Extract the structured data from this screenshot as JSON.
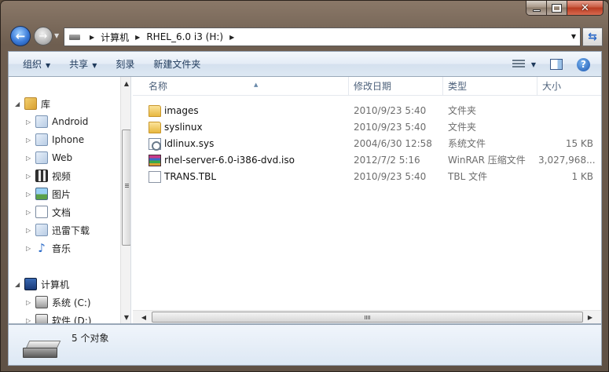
{
  "address": {
    "crumbs": [
      "计算机",
      "RHEL_6.0 i3 (H:)"
    ]
  },
  "toolbar": {
    "organize": "组织",
    "share": "共享",
    "burn": "刻录",
    "new_folder": "新建文件夹"
  },
  "nav": {
    "libraries_label": "库",
    "libraries": [
      "Android",
      "Iphone",
      "Web",
      "视频",
      "图片",
      "文档",
      "迅雷下载",
      "音乐"
    ],
    "computer_label": "计算机",
    "drives": [
      "系统 (C:)",
      "软件 (D:)"
    ]
  },
  "columns": {
    "name": "名称",
    "date": "修改日期",
    "type": "类型",
    "size": "大小"
  },
  "files": [
    {
      "name": "images",
      "date": "2010/9/23 5:40",
      "type": "文件夹",
      "size": "",
      "icon": "folder-icon"
    },
    {
      "name": "syslinux",
      "date": "2010/9/23 5:40",
      "type": "文件夹",
      "size": "",
      "icon": "folder-icon"
    },
    {
      "name": "ldlinux.sys",
      "date": "2004/6/30 12:58",
      "type": "系统文件",
      "size": "15 KB",
      "icon": "system-file-icon"
    },
    {
      "name": "rhel-server-6.0-i386-dvd.iso",
      "date": "2012/7/2 5:16",
      "type": "WinRAR 压缩文件",
      "size": "3,027,968...",
      "icon": "winrar-archive-icon"
    },
    {
      "name": "TRANS.TBL",
      "date": "2010/9/23 5:40",
      "type": "TBL 文件",
      "size": "1 KB",
      "icon": "generic-file-icon"
    }
  ],
  "status": {
    "count_text": "5 个对象"
  },
  "colors": {
    "window_frame": "#6e5e50",
    "command_bar": "#dde8f3",
    "header_text": "#4c607a",
    "detail_text": "#6d6d6d"
  }
}
